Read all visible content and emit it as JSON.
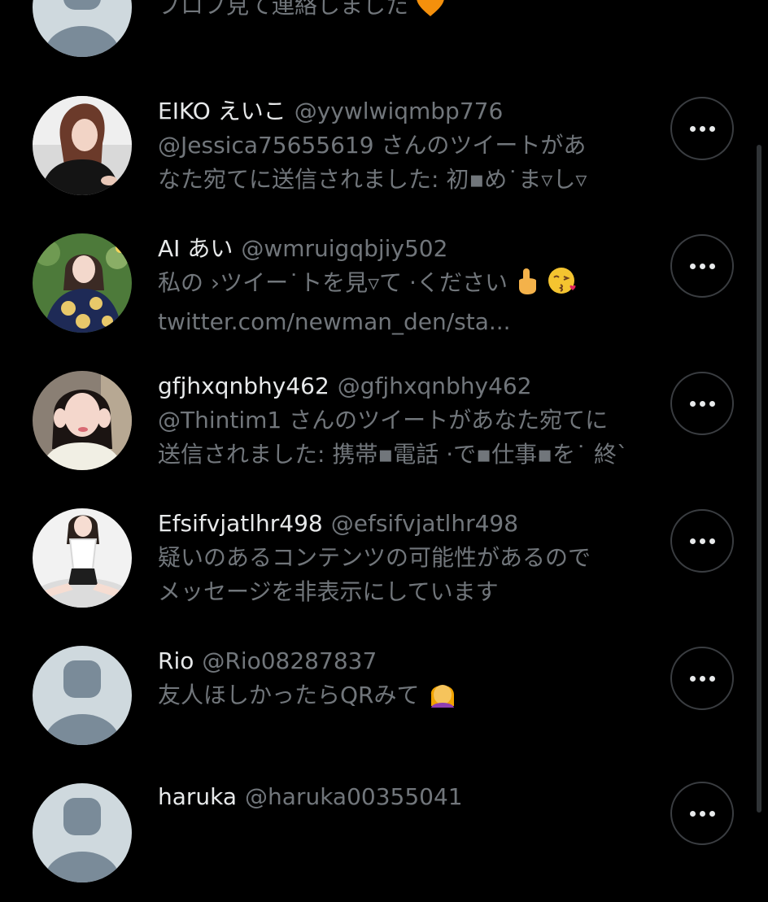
{
  "dms": [
    {
      "name": "",
      "handle": "",
      "line1": "プロフ見て連絡しました",
      "line2": "",
      "avatar": "default-avatar",
      "emoji": "orange-heart"
    },
    {
      "name": "EIKO えいこ",
      "handle": "@yywlwiqmbp776",
      "line1": "@Jessica75655619 さんのツイートがあ",
      "line2": "なた宛てに送信されました: 初▪め˙ま▿し▿",
      "avatar": "photo-avatar",
      "emoji": ""
    },
    {
      "name": "AI あい",
      "handle": "@wmruigqbjiy502",
      "line1": "私の ›ツイー˙トを見▿て ·ください",
      "line2": "twitter.com/newman_den/sta...",
      "avatar": "photo-avatar",
      "emoji": "pointing-kiss"
    },
    {
      "name": "gfjhxqnbhy462",
      "handle": "@gfjhxqnbhy462",
      "line1": "@Thintim1 さんのツイートがあなた宛てに",
      "line2": "送信されました: 携帯▪電話 ·で▪仕事▪を˙ 終`",
      "avatar": "photo-avatar",
      "emoji": ""
    },
    {
      "name": "Efsifvjatlhr498",
      "handle": "@efsifvjatlhr498",
      "line1": "疑いのあるコンテンツの可能性があるので",
      "line2": "メッセージを非表示にしています",
      "avatar": "photo-avatar",
      "emoji": ""
    },
    {
      "name": "Rio",
      "handle": "@Rio08287837",
      "line1": "友人ほしかったらQRみて",
      "line2": "",
      "avatar": "default-avatar",
      "emoji": "facepalm"
    },
    {
      "name": "haruka",
      "handle": "@haruka00355041",
      "line1": "",
      "line2": "",
      "avatar": "default-avatar",
      "emoji": ""
    }
  ],
  "colors": {
    "background": "#000000",
    "primary_text": "#e7e9ea",
    "secondary_text": "#71767b",
    "button_border": "#3a3d41",
    "default_avatar_bg": "#cfd9de",
    "default_avatar_fg": "#7a8b99"
  }
}
